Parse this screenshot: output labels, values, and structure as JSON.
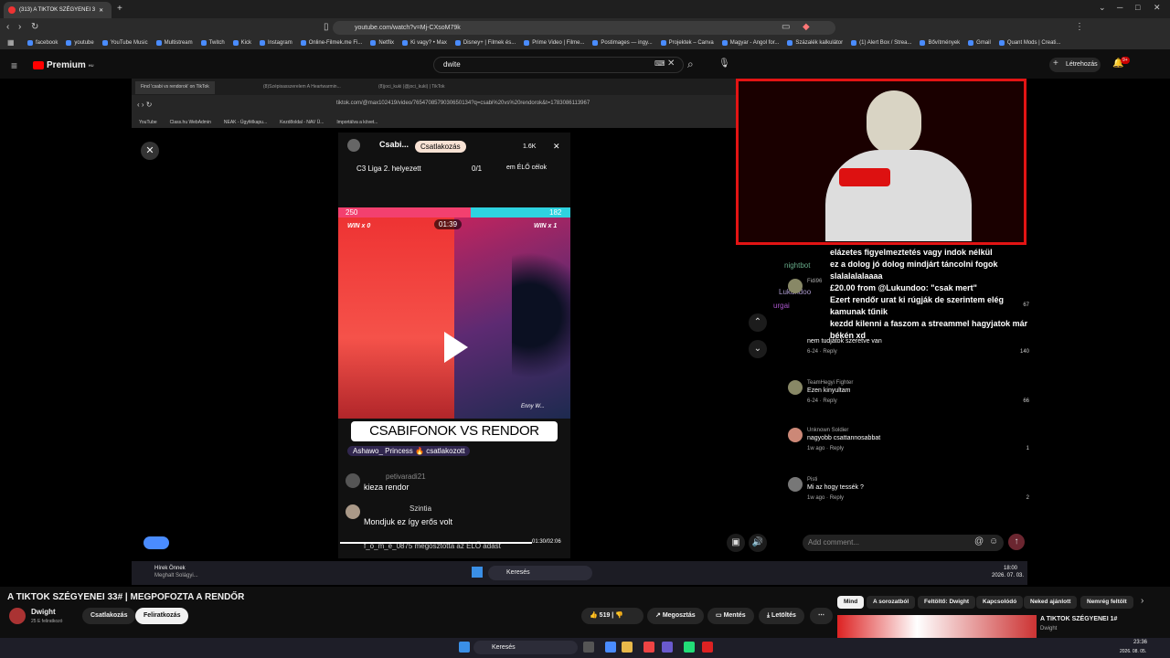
{
  "browser": {
    "tab_title": "(313) A TIKTOK SZÉGYENEI 3",
    "url": "youtube.com/watch?v=Mj-CXsoM79k",
    "bookmarks": [
      "facebook",
      "youtube",
      "YouTube Music",
      "Multistream",
      "Twitch",
      "Kick",
      "Instagram",
      "Online-Filmek.me Fi...",
      "Netflix",
      "Ki vagy? • Max",
      "Disney+ | Filmek és...",
      "Prime Video | Filme...",
      "Postimages — ingy...",
      "Projektek – Canva",
      "Magyar - Angol for...",
      "Százalék kalkulátor",
      "(1) Alert Box / Strea...",
      "Bővítmények",
      "Gmail",
      "Quant Mods | Creati..."
    ]
  },
  "youtube": {
    "logo_text": "Premium",
    "logo_badge": "HU",
    "search_value": "dwite",
    "create_label": "Létrehozás",
    "notif_count": "9+"
  },
  "inner_browser": {
    "tabs": [
      "Find 'csabi vs rendorok' on TikTok",
      "(8)Szépisasszerelem A Heartwarmin...",
      "(8)joci_kuki (@joci_kuki) | TikTok"
    ],
    "url": "tiktok.com/@max102419/video/7654708579030650134?q=csabi%20vs%20rendorok&t=1783086113967",
    "bookmarks": [
      "YouTube",
      "Class.hu WebAdmin",
      "NEAK - Ügyfélkapu...",
      "Kezdőoldal - NAV Ü...",
      "Importálva a követ..."
    ]
  },
  "tiktok": {
    "user": "Csabi...",
    "follow_label": "Csatlakozás",
    "viewers": "1.6K",
    "league": "C3 Liga 2. helyezett",
    "score": "0/1",
    "goal": "em ÉLŐ célok",
    "left_score": "250",
    "right_score": "182",
    "timer": "01:39",
    "win_left": "WIN x 0",
    "win_right": "WIN x 1",
    "right_user": "Enny W...",
    "overlay_title": "CSABIFONOK VS RENDOR",
    "joined_text": "Ashawo_ Princess",
    "joined_action": "csatlakozott",
    "comments": [
      {
        "user": "petivaradi21",
        "text": "kieza rendor",
        "level": "13"
      },
      {
        "user": "Szintia",
        "text": "Mondjuk ez így erős volt",
        "level": "19"
      }
    ],
    "share_text": "f_o_m_e_0875 megosztotta az ÉLŐ adást",
    "time_progress": "01:30/02:06"
  },
  "chat_overlay": [
    "elázetes figyelmeztetés vagy indok nélkül",
    "ez a dolog jó dolog mindjárt táncolni fogok",
    "slalalalalaaaa",
    "£20.00 from @Lukundoo: \"csak mert\"",
    "Ezert rendőr urat ki rúgják de szerintem elég kamunak tűnik",
    "kezdd kilenni a faszom a streammel hagyjatok már békén xd"
  ],
  "chat_users": [
    "nightbot",
    "Lukundoo",
    "urgai"
  ],
  "yt_comments": [
    {
      "user": "Fidi96",
      "text": "",
      "time": "",
      "likes": "67"
    },
    {
      "user": "",
      "text": "nem tudjátok szeretve van",
      "time": "6-24",
      "likes": "140"
    },
    {
      "user": "TeamHegyi Fighter",
      "text": "Ezen kinyultam",
      "time": "6-24",
      "likes": "66"
    },
    {
      "user": "Unknown Soldier",
      "text": "nagyobb csattannosabbat",
      "time": "1w ago",
      "likes": "1"
    },
    {
      "user": "Pisti",
      "text": "Mi az hogy tessék ?",
      "time": "1w ago",
      "likes": "2"
    }
  ],
  "reply_label": "Reply",
  "add_comment_placeholder": "Add comment...",
  "inner_taskbar": {
    "news_title": "Hírek Önnek",
    "news_sub": "Meghalt Solágyi...",
    "search": "Keresés",
    "time": "18:00",
    "date": "2026. 07. 03."
  },
  "video": {
    "title": "A TIKTOK SZÉGYENEI 33# | MEGPOFOZTA A RENDŐR",
    "channel": "Dwight",
    "subscribers": "25 E feliratkozó",
    "join_label": "Csatlakozás",
    "subscribe_label": "Feliratkozás",
    "likes": "519",
    "share_label": "Megosztás",
    "save_label": "Mentés",
    "download_label": "Letöltés"
  },
  "chips": [
    "Mind",
    "A sorozatból",
    "Feltöltő: Dwight",
    "Kapcsolódó",
    "Neked ajánlott",
    "Nemrég feltölt"
  ],
  "next_video": {
    "title": "A TIKTOK SZÉGYENEI 1#",
    "channel": "Dwight"
  },
  "taskbar": {
    "search": "Keresés",
    "time": "23:36",
    "date": "2026. 08. 05."
  }
}
